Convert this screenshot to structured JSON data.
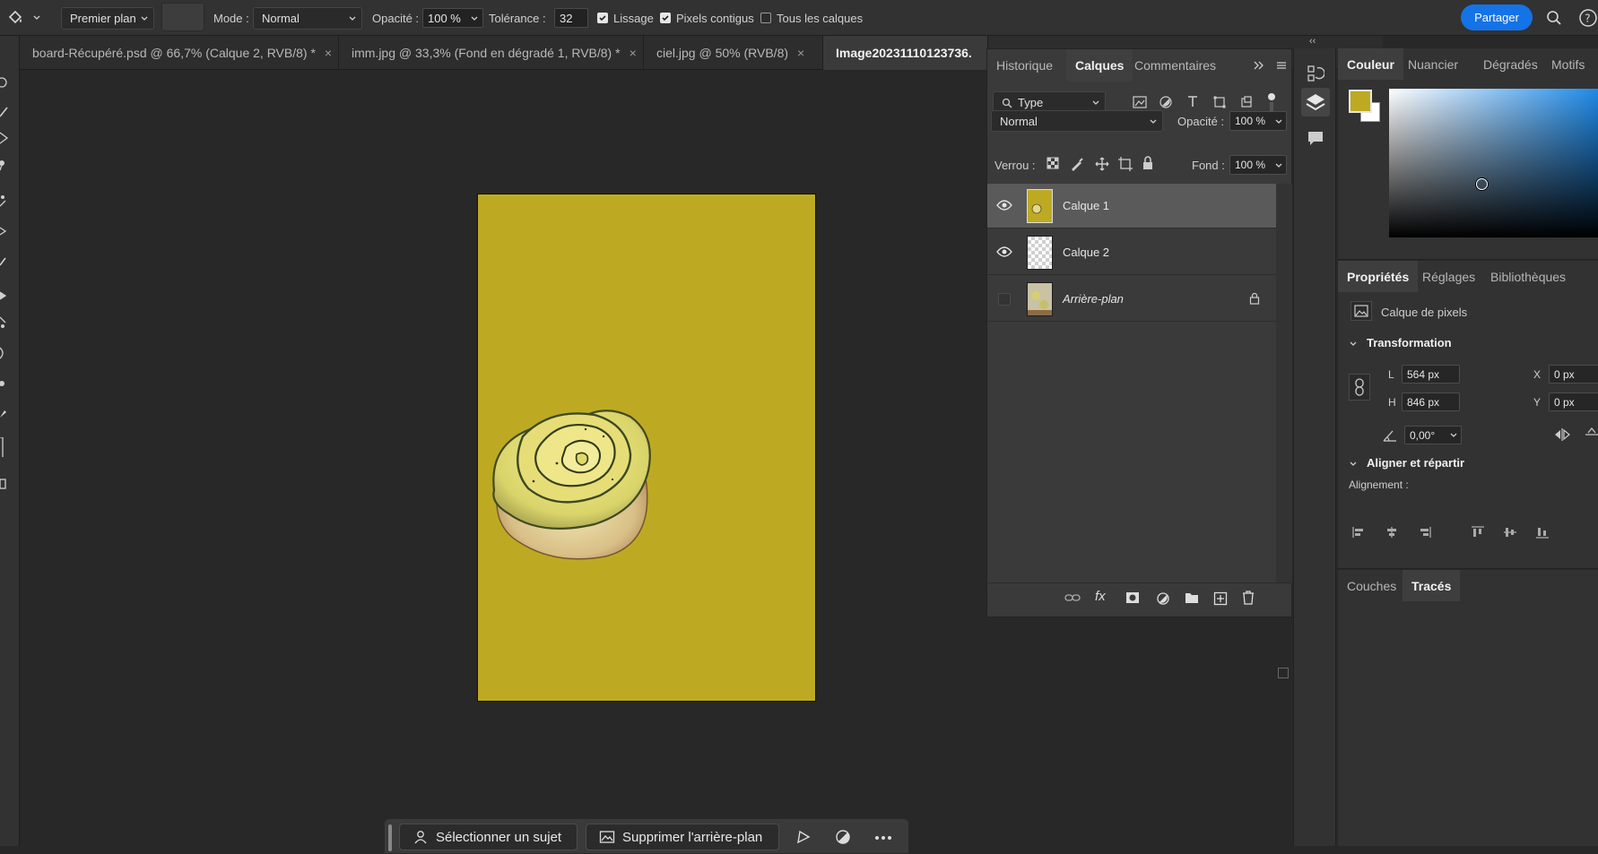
{
  "options_bar": {
    "foreground_select": "Premier plan",
    "mode_label": "Mode :",
    "mode_value": "Normal",
    "opacity_label": "Opacité :",
    "opacity_value": "100 %",
    "tolerance_label": "Tolérance :",
    "tolerance_value": "32",
    "smoothing_label": "Lissage",
    "smoothing_checked": true,
    "contiguous_label": "Pixels contigus",
    "contiguous_checked": true,
    "all_layers_label": "Tous les calques",
    "all_layers_checked": false,
    "share_label": "Partager",
    "share_color": "#1473e6"
  },
  "tabs": [
    {
      "label": "board-Récupéré.psd @ 66,7% (Calque 2, RVB/8) *",
      "close": "×"
    },
    {
      "label": "imm.jpg @ 33,3% (Fond en dégradé 1, RVB/8) *",
      "close": "×"
    },
    {
      "label": "ciel.jpg @ 50% (RVB/8)",
      "close": "×"
    },
    {
      "label": "Image20231110123736.",
      "close": ""
    }
  ],
  "document": {
    "fill_color": "#beaa22",
    "subject": "zucchini rose tart"
  },
  "task_bar": {
    "select_subject": "Sélectionner un sujet",
    "remove_background": "Supprimer l'arrière-plan"
  },
  "layers_panel": {
    "tabs": [
      "Historique",
      "Calques",
      "Commentaires"
    ],
    "active_tab": "Calques",
    "filter_type": "Type",
    "blend_mode": "Normal",
    "opacity_label": "Opacité :",
    "opacity_value": "100 %",
    "lock_label": "Verrou :",
    "fill_label": "Fond :",
    "fill_value": "100 %",
    "layers": [
      {
        "name": "Calque 1",
        "visible": true,
        "selected": true
      },
      {
        "name": "Calque 2",
        "visible": true,
        "selected": false
      },
      {
        "name": "Arrière-plan",
        "visible": false,
        "selected": false,
        "locked": true
      }
    ]
  },
  "color_panel": {
    "tabs": [
      "Couleur",
      "Nuancier",
      "Dégradés",
      "Motifs"
    ],
    "foreground": "#beaa22",
    "background": "#ffffff"
  },
  "properties_panel": {
    "tabs": [
      "Propriétés",
      "Réglages",
      "Bibliothèques"
    ],
    "kind": "Calque de pixels",
    "transform_title": "Transformation",
    "w_label": "L",
    "w_value": "564 px",
    "h_label": "H",
    "h_value": "846 px",
    "x_label": "X",
    "x_value": "0 px",
    "y_label": "Y",
    "y_value": "0 px",
    "angle_value": "0,00°",
    "align_title": "Aligner et répartir",
    "align_label": "Alignement :"
  },
  "paths_panel": {
    "tabs": [
      "Couches",
      "Tracés"
    ],
    "active_tab": "Tracés"
  }
}
